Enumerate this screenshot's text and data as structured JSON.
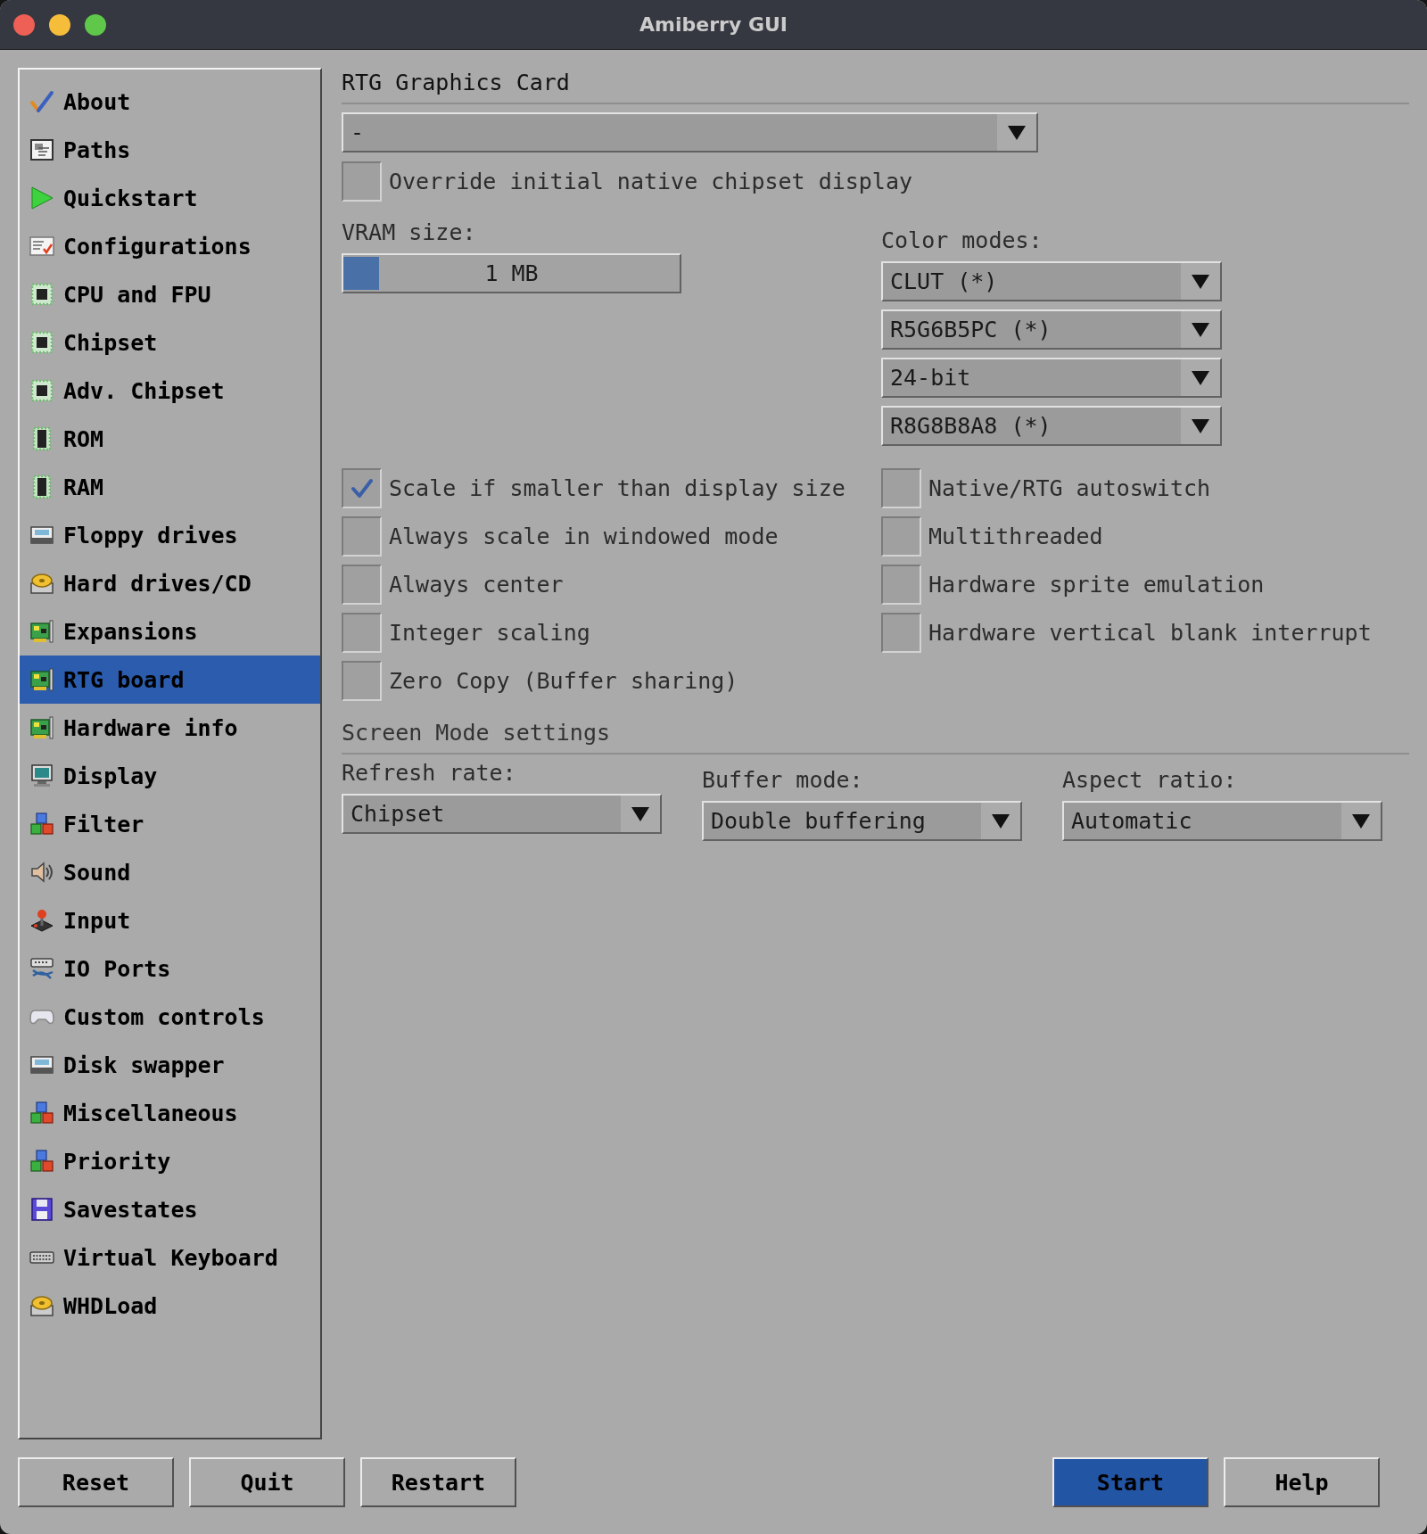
{
  "window": {
    "title": "Amiberry GUI"
  },
  "sidebar": {
    "items": [
      {
        "label": "About",
        "selected": false
      },
      {
        "label": "Paths",
        "selected": false
      },
      {
        "label": "Quickstart",
        "selected": false
      },
      {
        "label": "Configurations",
        "selected": false
      },
      {
        "label": "CPU and FPU",
        "selected": false
      },
      {
        "label": "Chipset",
        "selected": false
      },
      {
        "label": "Adv. Chipset",
        "selected": false
      },
      {
        "label": "ROM",
        "selected": false
      },
      {
        "label": "RAM",
        "selected": false
      },
      {
        "label": "Floppy drives",
        "selected": false
      },
      {
        "label": "Hard drives/CD",
        "selected": false
      },
      {
        "label": "Expansions",
        "selected": false
      },
      {
        "label": "RTG board",
        "selected": true
      },
      {
        "label": "Hardware info",
        "selected": false
      },
      {
        "label": "Display",
        "selected": false
      },
      {
        "label": "Filter",
        "selected": false
      },
      {
        "label": "Sound",
        "selected": false
      },
      {
        "label": "Input",
        "selected": false
      },
      {
        "label": "IO Ports",
        "selected": false
      },
      {
        "label": "Custom controls",
        "selected": false
      },
      {
        "label": "Disk swapper",
        "selected": false
      },
      {
        "label": "Miscellaneous",
        "selected": false
      },
      {
        "label": "Priority",
        "selected": false
      },
      {
        "label": "Savestates",
        "selected": false
      },
      {
        "label": "Virtual Keyboard",
        "selected": false
      },
      {
        "label": "WHDLoad",
        "selected": false
      }
    ]
  },
  "rtg_graphics_card": {
    "title": "RTG Graphics Card",
    "board": {
      "value": "-"
    },
    "override_native": {
      "label": "Override initial native chipset display",
      "checked": false
    },
    "vram_size": {
      "label": "VRAM size:",
      "level": 0,
      "reading": "1 MB"
    },
    "color_modes": {
      "label": "Color modes:",
      "dropdowns": [
        {
          "value": "CLUT (*)"
        },
        {
          "value": "R5G6B5PC (*)"
        },
        {
          "value": "24-bit"
        },
        {
          "value": "R8G8B8A8 (*)"
        }
      ]
    },
    "options_left": [
      {
        "label": "Scale if smaller than display size",
        "checked": true
      },
      {
        "label": "Always scale in windowed mode",
        "checked": false
      },
      {
        "label": "Always center",
        "checked": false
      },
      {
        "label": "Integer scaling",
        "checked": false
      },
      {
        "label": "Zero Copy (Buffer sharing)",
        "checked": false
      }
    ],
    "options_right": [
      {
        "label": "Native/RTG autoswitch",
        "checked": false
      },
      {
        "label": "Multithreaded",
        "checked": false
      },
      {
        "label": "Hardware sprite emulation",
        "checked": false
      },
      {
        "label": "Hardware vertical blank interrupt",
        "checked": false
      }
    ]
  },
  "screen_mode_settings": {
    "title": "Screen Mode settings",
    "fields": [
      {
        "label": "Refresh rate:",
        "value": "Chipset"
      },
      {
        "label": "Buffer mode:",
        "value": "Double buffering"
      },
      {
        "label": "Aspect ratio:",
        "value": "Automatic"
      }
    ]
  },
  "buttons_left": [
    {
      "label": "Reset",
      "kind": "normal"
    },
    {
      "label": "Quit",
      "kind": "normal"
    },
    {
      "label": "Restart",
      "kind": "normal"
    }
  ],
  "buttons_right": [
    {
      "label": "Start",
      "kind": "primary"
    },
    {
      "label": "Help",
      "kind": "normal"
    }
  ]
}
